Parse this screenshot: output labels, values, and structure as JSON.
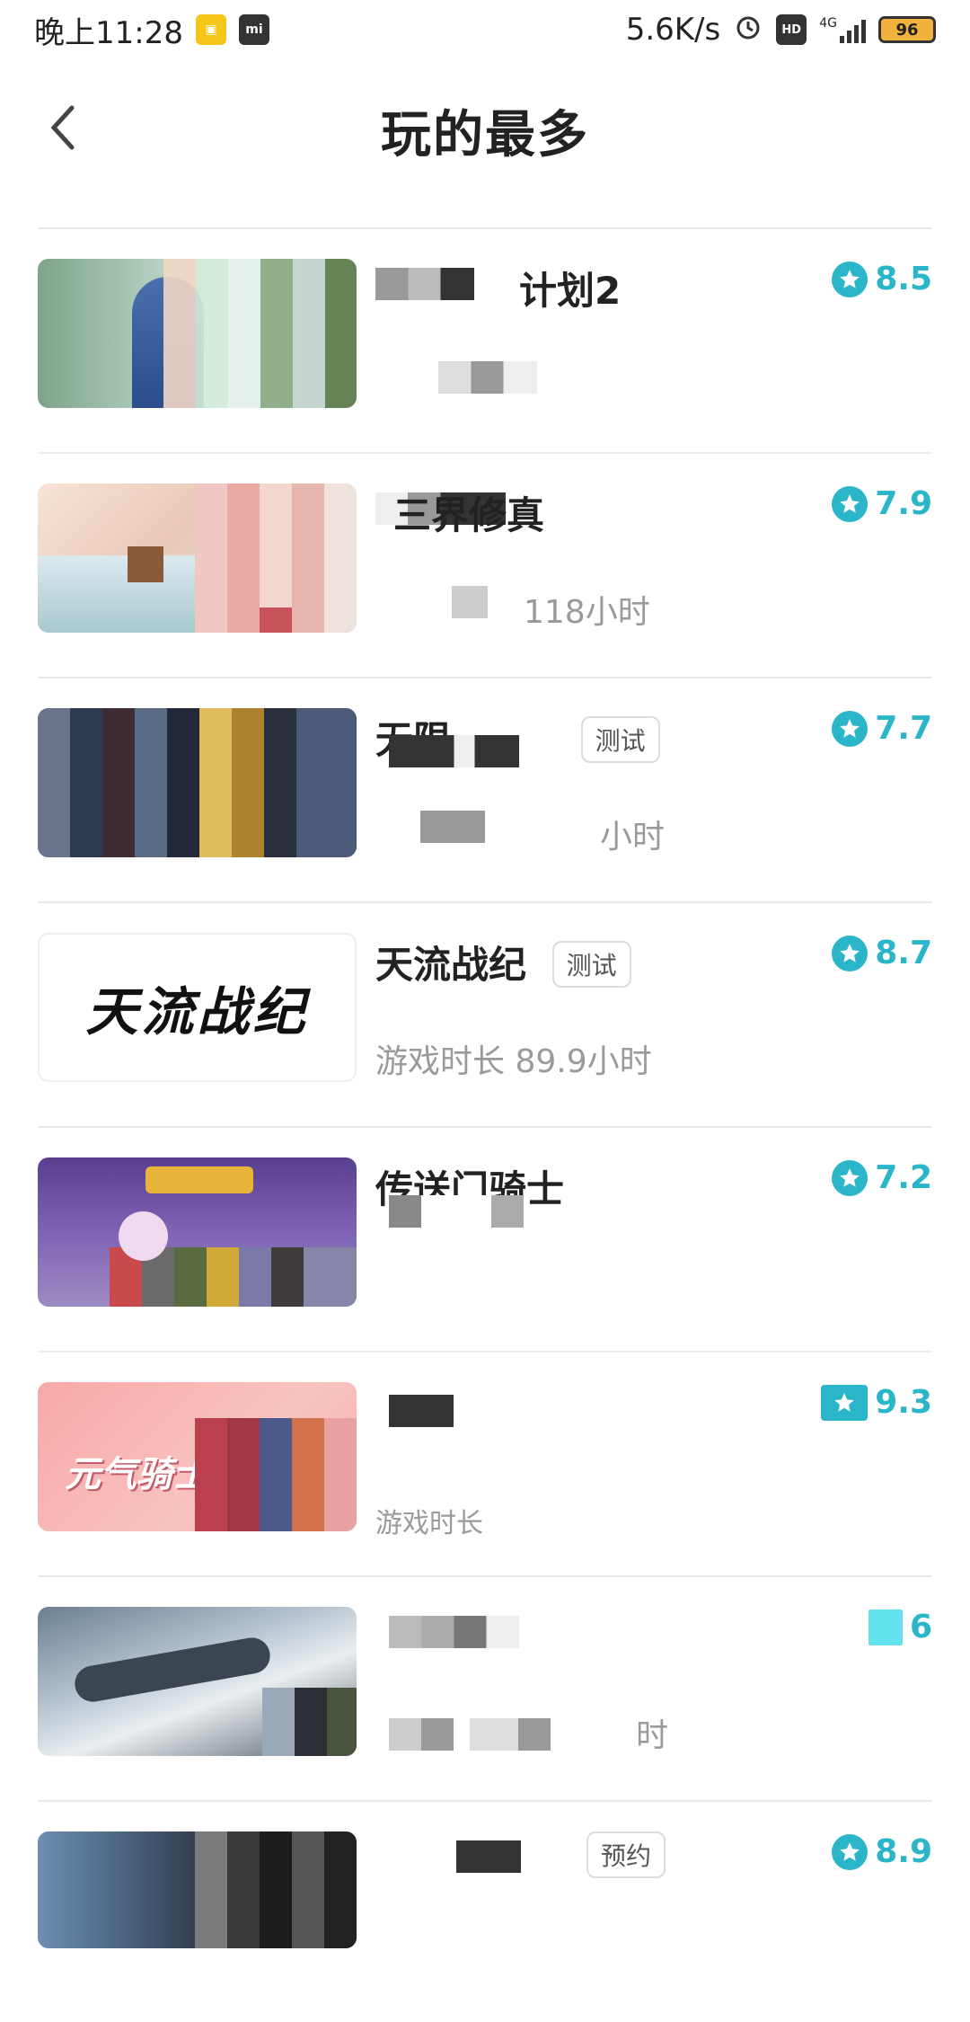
{
  "status_bar": {
    "time": "晚上11:28",
    "network_speed": "5.6K/s",
    "hd_label": "HD",
    "network_type": "4G",
    "battery": "96"
  },
  "header": {
    "title": "玩的最多"
  },
  "games": [
    {
      "name": "计划2",
      "badge": "",
      "subtitle": "",
      "rating": "8.5"
    },
    {
      "name": "三界修真",
      "badge": "",
      "subtitle": "118小时",
      "rating": "7.9"
    },
    {
      "name": "无限",
      "badge": "测试",
      "subtitle": "小时",
      "rating": "7.7"
    },
    {
      "name": "天流战纪",
      "badge": "测试",
      "subtitle": "游戏时长 89.9小时",
      "rating": "8.7"
    },
    {
      "name": "传送门骑士",
      "badge": "",
      "subtitle": "",
      "rating": "7.2"
    },
    {
      "name": "",
      "badge": "",
      "subtitle": "游戏时长",
      "rating": "9.3"
    },
    {
      "name": "",
      "badge": "",
      "subtitle": "时",
      "rating": "6"
    },
    {
      "name": "",
      "badge": "预约",
      "subtitle": "",
      "rating": "8.9"
    }
  ],
  "thumbnails": {
    "t2_text": "元气骑士",
    "t3_text": "天流战纪"
  },
  "colors": {
    "accent": "#2ab5c9",
    "badge_border": "#dcdcdc",
    "subtitle": "#9a9a9a"
  }
}
